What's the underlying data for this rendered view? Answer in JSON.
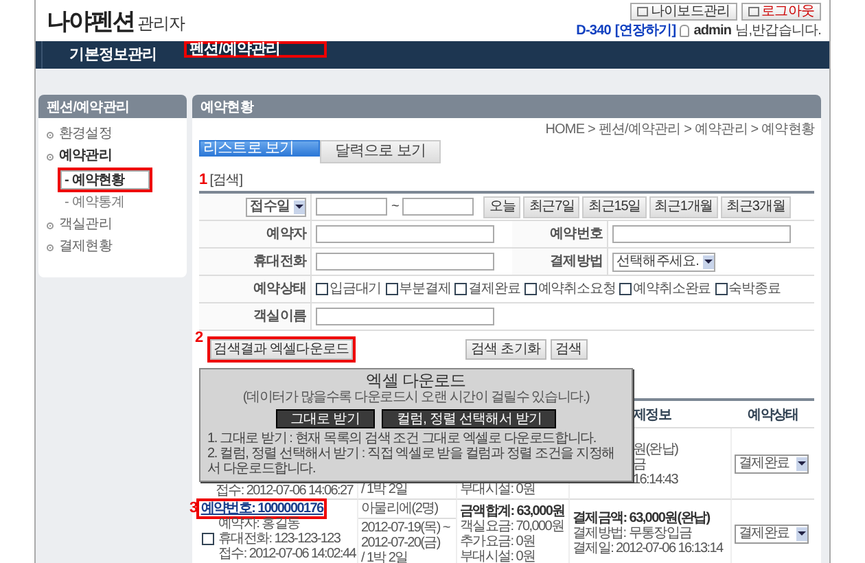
{
  "header": {
    "logo": "나야펜션",
    "logo_sub": "관리자",
    "buttons": [
      {
        "label": "나이보드관리",
        "kind": "board"
      },
      {
        "label": "로그아웃",
        "kind": "logout"
      }
    ],
    "account_code": "D-340",
    "extend_link": "[연장하기]",
    "user": "admin",
    "greeting": "님,반갑습니다."
  },
  "nav": [
    {
      "label": "기본정보관리",
      "selected": false,
      "highlighted": false
    },
    {
      "label": "펜션/예약관리",
      "selected": true,
      "highlighted": true
    }
  ],
  "sidebar": {
    "title": "펜션/예약관리",
    "items": [
      {
        "label": "환경설정",
        "expanded": false
      },
      {
        "label": "예약관리",
        "expanded": true,
        "children": [
          {
            "label": "- 예약현황",
            "selected": true,
            "highlighted": true
          },
          {
            "label": "- 예약통계",
            "selected": false,
            "highlighted": false
          }
        ]
      },
      {
        "label": "객실관리",
        "expanded": false
      },
      {
        "label": "결제현황",
        "expanded": false
      }
    ]
  },
  "content": {
    "title": "예약현황",
    "breadcrumb": "HOME > 펜션/예약관리 > 예약관리 > 예약현황",
    "view_tabs": [
      {
        "label": "리스트로 보기",
        "selected": true
      },
      {
        "label": "달력으로 보기",
        "selected": false
      }
    ],
    "search_marker": "1",
    "search_label": "[검색]",
    "search": {
      "date_select": "접수일",
      "range_separator": "~",
      "quick_buttons": [
        "오늘",
        "최근7일",
        "최근15일",
        "최근1개월",
        "최근3개월"
      ],
      "rows": [
        [
          {
            "label": "예약자",
            "kind": "text"
          },
          {
            "label": "예약번호",
            "kind": "text"
          }
        ],
        [
          {
            "label": "휴대전화",
            "kind": "text"
          },
          {
            "label": "결제방법",
            "kind": "select",
            "value": "선택해주세요."
          }
        ],
        [
          {
            "label": "예약상태",
            "kind": "checks",
            "options": [
              {
                "label": "입금대기",
                "checked": false
              },
              {
                "label": "부분결제",
                "checked": false
              },
              {
                "label": "결제완료",
                "checked": false
              },
              {
                "label": "예약취소요청",
                "checked": false
              },
              {
                "label": "예약취소완료",
                "checked": false
              },
              {
                "label": "숙박종료",
                "checked": false
              }
            ]
          }
        ],
        [
          {
            "label": "객실이름",
            "kind": "text"
          }
        ]
      ]
    },
    "actions": {
      "excel_button": {
        "label": "검색결과 엑셀다운로드",
        "marker": "2",
        "highlighted": true
      },
      "reset_button": "검색 초기화",
      "search_button": "검색"
    },
    "popup": {
      "title": "엑셀 다운로드",
      "subtitle": "(데이터가 많을수록 다운로드시 오랜 시간이 걸릴수 있습니다.)",
      "buttons": [
        "그대로 받기",
        "컬럼, 정렬 선택해서 받기"
      ],
      "notes": [
        "1. 그대로 받기 : 현재 목록의 검색 조건 그대로 엑셀로 다운로드합니다.",
        "2. 컬럼, 정렬 선택해서 받기 : 직접 엑셀로 받을 컬럼과 정렬 조건을 지정해서 다운로드합니다."
      ]
    },
    "results": {
      "columns": {
        "column_4": "제정보",
        "column_5": "예약상태"
      },
      "rows": [
        {
          "customer": [
            "접수: 2012-07-06 14:06:27"
          ],
          "stay": [
            "/ 1박 2일"
          ],
          "amount": [
            "부대시설: 0원"
          ],
          "payment": [
            "원(완납)",
            "금",
            "16:14:43"
          ],
          "status": "결제완료"
        },
        {
          "checked": false,
          "number_link": "예약번호: 1000000176",
          "marker": "3",
          "highlighted": true,
          "room": "아물리에(2명)",
          "customer": [
            "예약자: 홍길동",
            "휴대전화: 123-123-123",
            "접수: 2012-07-06 14:02:44"
          ],
          "stay": [
            "2012-07-19(목) ~",
            "2012-07-20(금)",
            "/ 1박 2일"
          ],
          "amount": [
            "금액합계: 63,000원",
            "객실요금: 70,000원",
            "추가요금: 0원",
            "부대시설: 0원"
          ],
          "payment": [
            "결제금액: 63,000원(완납)",
            "결제방법: 무통장입금",
            "결제일: 2012-07-06 16:13:14"
          ],
          "status": "결제완료"
        }
      ]
    }
  }
}
